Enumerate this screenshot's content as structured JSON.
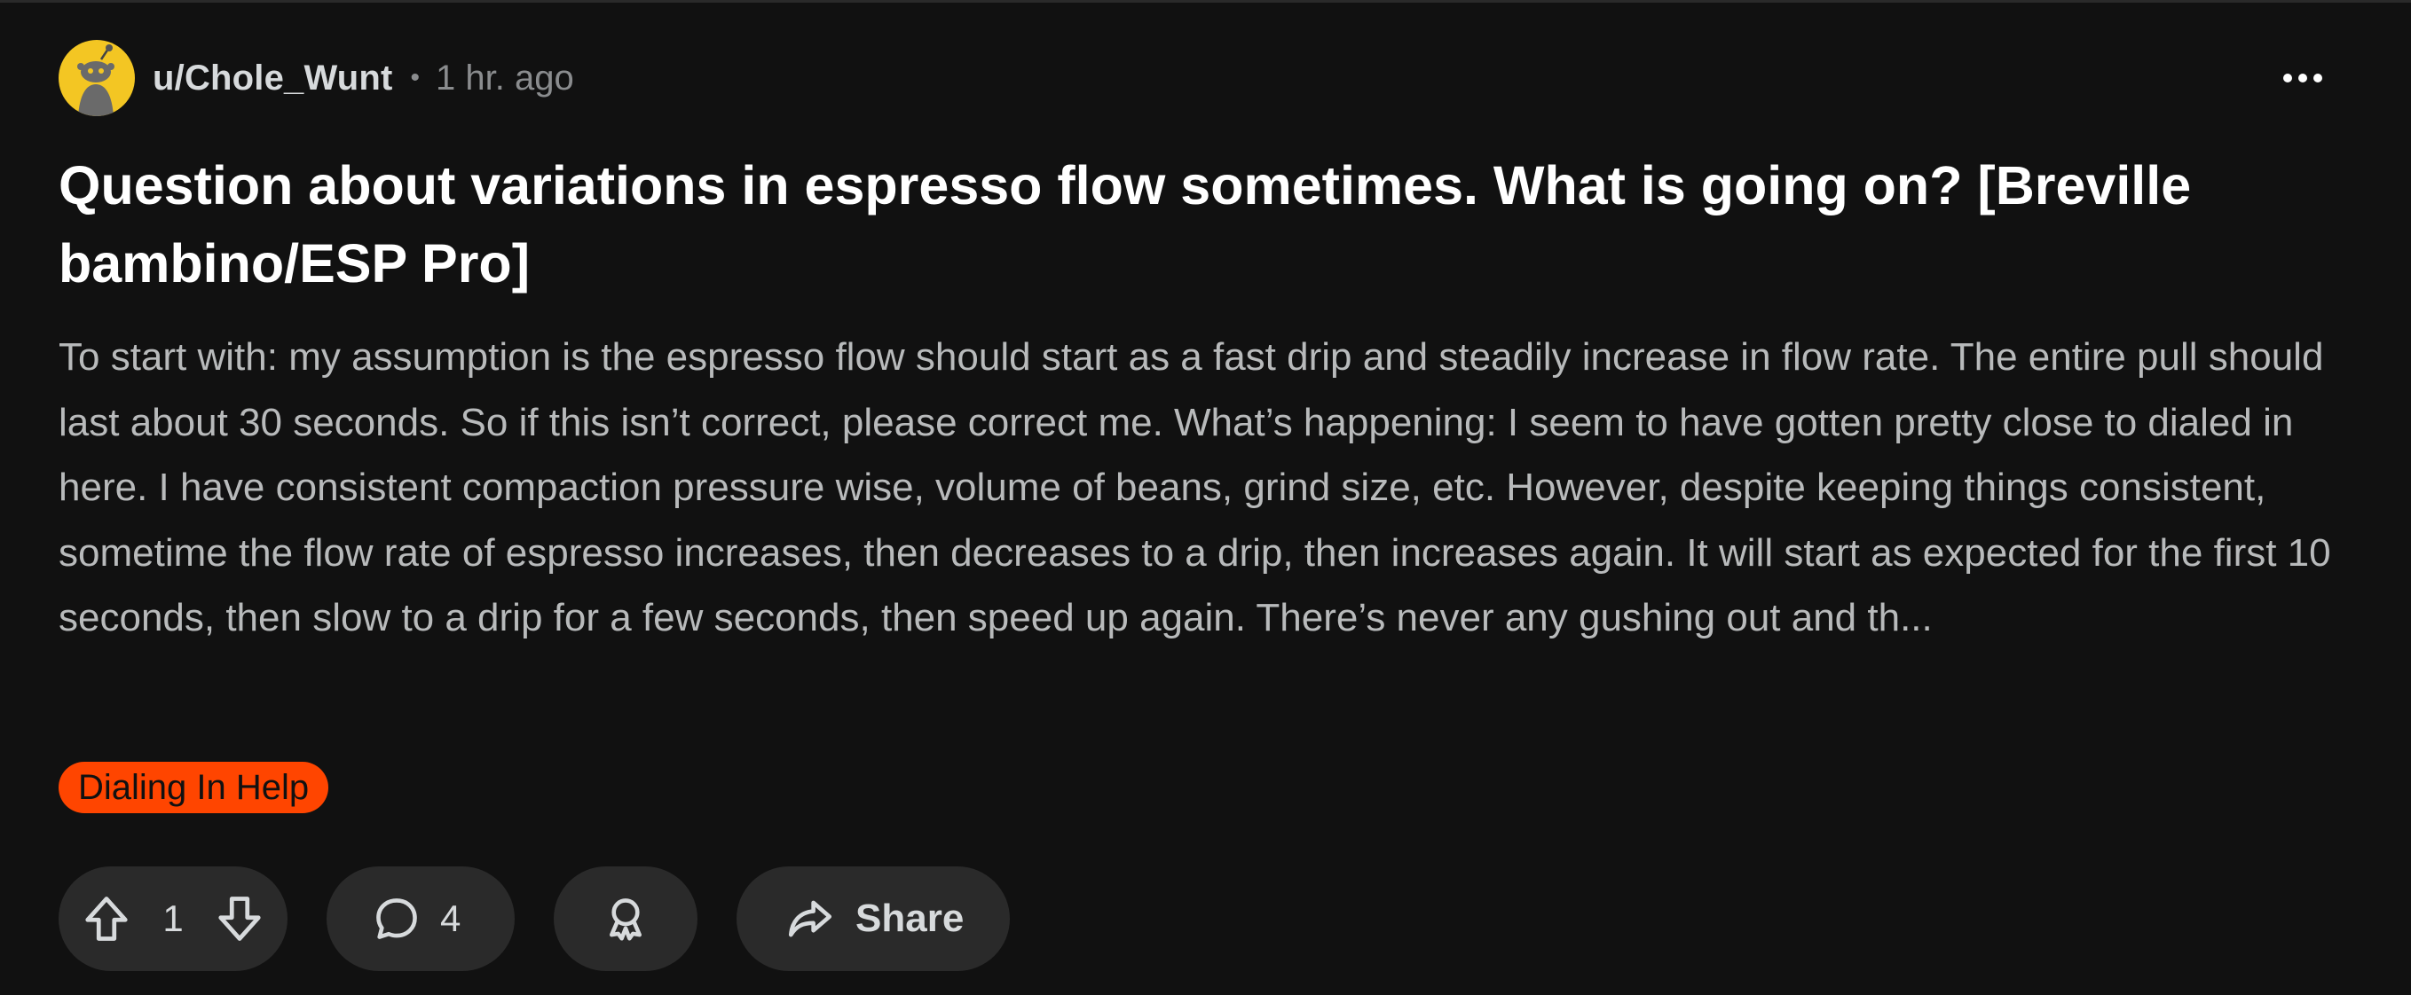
{
  "post": {
    "author": "u/Chole_Wunt",
    "separator": "•",
    "timestamp": "1 hr. ago",
    "title": "Question about variations in espresso flow sometimes. What is going on? [Breville bambino/ESP Pro]",
    "body": "To start with: my assumption is the espresso flow should start as a fast drip and steadily increase in flow rate. The entire pull should last about 30 seconds. So if this isn’t correct, please correct me. What’s happening: I seem to have gotten pretty close to dialed in here. I have consistent compaction pressure wise, volume of beans, grind size, etc. However, despite keeping things consistent, sometime the flow rate of espresso increases, then decreases to a drip, then increases again. It will start as expected for the first 10 seconds, then slow to a drip for a few seconds, then speed up again. There’s never any gushing out and th...",
    "flair": "Dialing In Help",
    "flair_color": "#ff4500"
  },
  "actions": {
    "vote_count": "1",
    "comment_count": "4",
    "share_label": "Share"
  },
  "icons": {
    "avatar": "snoo-avatar-icon",
    "more": "more-options-icon",
    "upvote": "upvote-arrow-icon",
    "downvote": "downvote-arrow-icon",
    "comment": "comment-bubble-icon",
    "award": "award-icon",
    "share": "share-arrow-icon"
  },
  "colors": {
    "background": "#111111",
    "pill": "#2a2a2a",
    "avatar_bg": "#f3c623"
  }
}
